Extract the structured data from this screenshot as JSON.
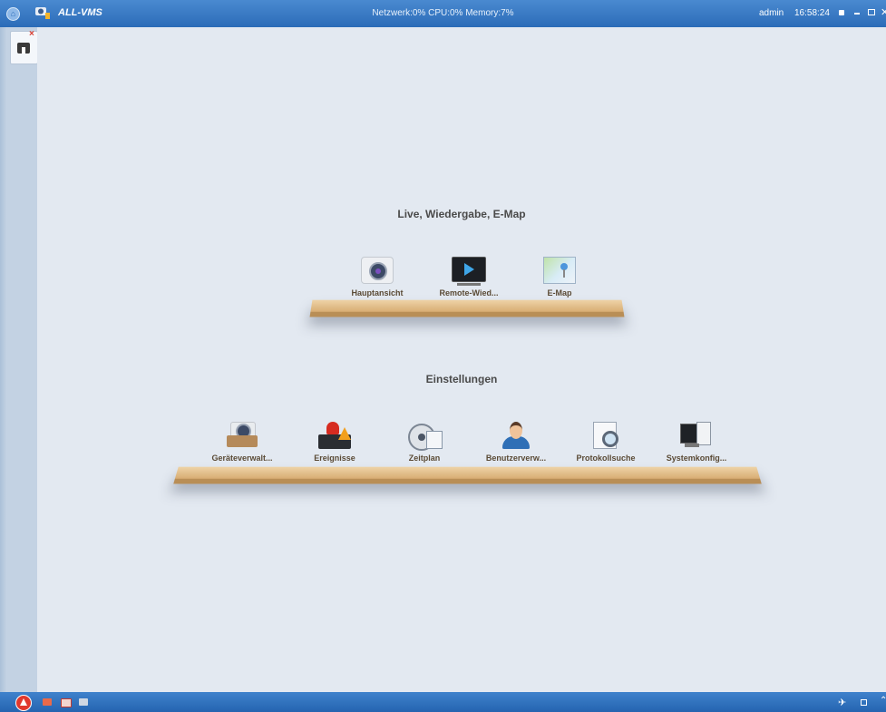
{
  "titlebar": {
    "app_name": "ALL-VMS",
    "status": "Netzwerk:0% CPU:0% Memory:7%",
    "user": "admin",
    "clock": "16:58:24"
  },
  "sections": [
    {
      "title": "Live, Wiedergabe, E-Map",
      "items": [
        {
          "label": "Hauptansicht",
          "icon": "camera-icon"
        },
        {
          "label": "Remote-Wied...",
          "icon": "playback-monitor-icon"
        },
        {
          "label": "E-Map",
          "icon": "map-icon"
        }
      ]
    },
    {
      "title": "Einstellungen",
      "items": [
        {
          "label": "Geräteverwalt...",
          "icon": "device-management-icon"
        },
        {
          "label": "Ereignisse",
          "icon": "alarm-siren-icon"
        },
        {
          "label": "Zeitplan",
          "icon": "schedule-reel-icon"
        },
        {
          "label": "Benutzerverw...",
          "icon": "user-icon"
        },
        {
          "label": "Protokollsuche",
          "icon": "log-search-icon"
        },
        {
          "label": "Systemkonfig...",
          "icon": "system-config-icon"
        }
      ]
    }
  ],
  "colors": {
    "titlebar": "#2b6cb8",
    "background": "#e3e9f1",
    "shelf": "#e6c48f"
  }
}
